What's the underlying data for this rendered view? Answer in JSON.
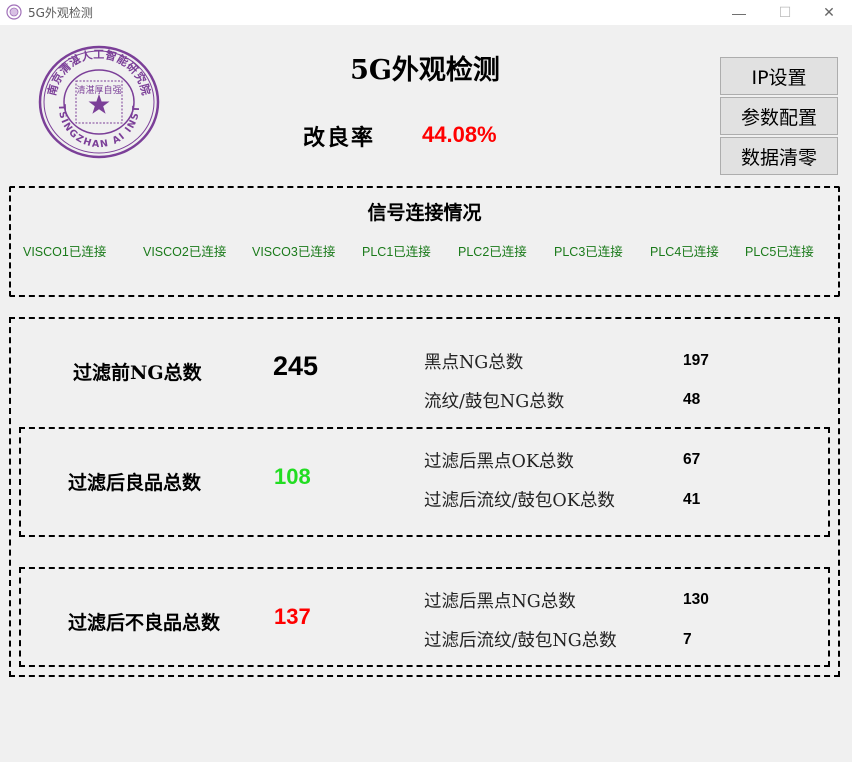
{
  "window": {
    "title": "5G外观检测",
    "minimize": "—",
    "maximize": "☐",
    "close": "✕"
  },
  "logo": {
    "text_top": "南京清湛人工智能研究院",
    "text_bottom": "TSINGZHAN AI INST",
    "motto": "清湛厚自强",
    "color": "#7b3f98"
  },
  "header": {
    "title": "5G外观检测",
    "rate_label": "改良率",
    "rate_value": "44.08%"
  },
  "buttons": {
    "ip": "IP设置",
    "params": "参数配置",
    "clear": "数据清零"
  },
  "signals": {
    "title": "信号连接情况",
    "items": [
      "VISCO1已连接",
      "VISCO2已连接",
      "VISCO3已连接",
      "PLC1已连接",
      "PLC2已连接",
      "PLC3已连接",
      "PLC4已连接",
      "PLC5已连接"
    ],
    "color": "#1a7a1a"
  },
  "stats": {
    "before": {
      "label": "过滤前NG总数",
      "value": "245",
      "details": [
        {
          "label": "黑点NG总数",
          "value": "197"
        },
        {
          "label": "流纹/鼓包NG总数",
          "value": "48"
        }
      ]
    },
    "good": {
      "label": "过滤后良品总数",
      "value": "108",
      "color": "#22dd22",
      "details": [
        {
          "label": "过滤后黑点OK总数",
          "value": "67"
        },
        {
          "label": "过滤后流纹/鼓包OK总数",
          "value": "41"
        }
      ]
    },
    "bad": {
      "label": "过滤后不良品总数",
      "value": "137",
      "color": "#ff0000",
      "details": [
        {
          "label": "过滤后黑点NG总数",
          "value": "130"
        },
        {
          "label": "过滤后流纹/鼓包NG总数",
          "value": "7"
        }
      ]
    }
  }
}
